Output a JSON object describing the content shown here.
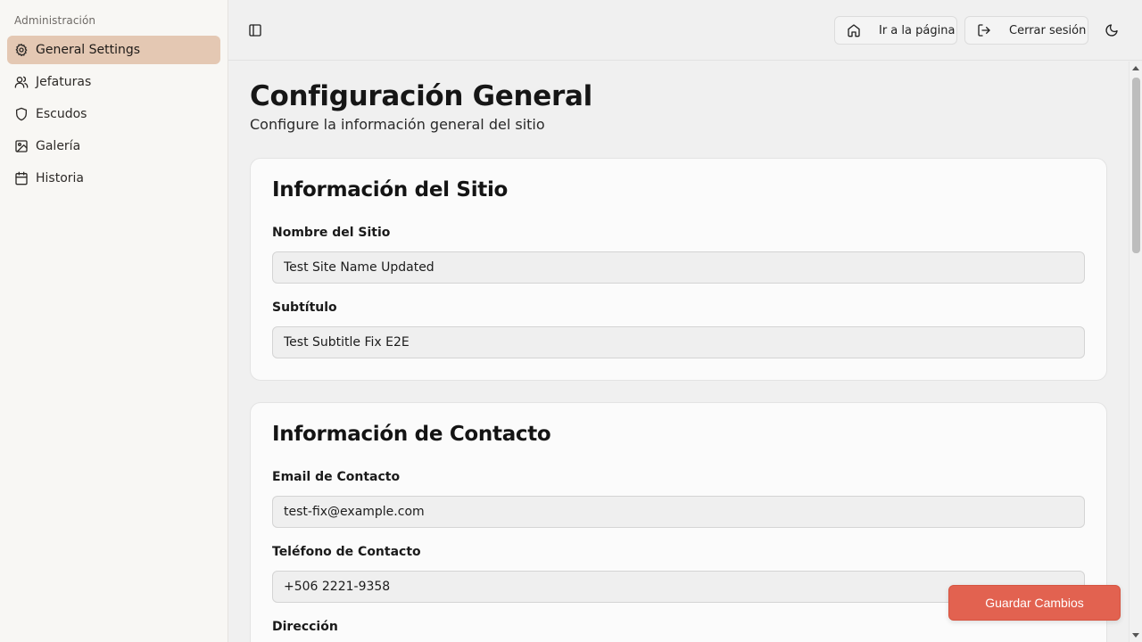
{
  "sidebar": {
    "group_label": "Administración",
    "items": [
      {
        "label": "General Settings",
        "icon": "gear-icon",
        "active": true
      },
      {
        "label": "Jefaturas",
        "icon": "users-icon",
        "active": false
      },
      {
        "label": "Escudos",
        "icon": "shield-icon",
        "active": false
      },
      {
        "label": "Galería",
        "icon": "image-icon",
        "active": false
      },
      {
        "label": "Historia",
        "icon": "calendar-icon",
        "active": false
      }
    ]
  },
  "header": {
    "toggle_icon": "sidebar-toggle-icon",
    "go_to_page_label": "Ir a la página",
    "logout_label": "Cerrar sesión",
    "theme_icon": "moon-icon"
  },
  "page": {
    "title": "Configuración General",
    "subtitle": "Configure la información general del sitio"
  },
  "site_info": {
    "title": "Información del Sitio",
    "site_name_label": "Nombre del Sitio",
    "site_name_value": "Test Site Name Updated",
    "subtitle_label": "Subtítulo",
    "subtitle_value": "Test Subtitle Fix E2E"
  },
  "contact_info": {
    "title": "Información de Contacto",
    "email_label": "Email de Contacto",
    "email_value": "test-fix@example.com",
    "phone_label": "Teléfono de Contacto",
    "phone_value": "+506 2221-9358",
    "address_label": "Dirección"
  },
  "actions": {
    "save_label": "Guardar Cambios"
  },
  "colors": {
    "accent": "#e26250",
    "active_nav": "#e4c8b3"
  }
}
